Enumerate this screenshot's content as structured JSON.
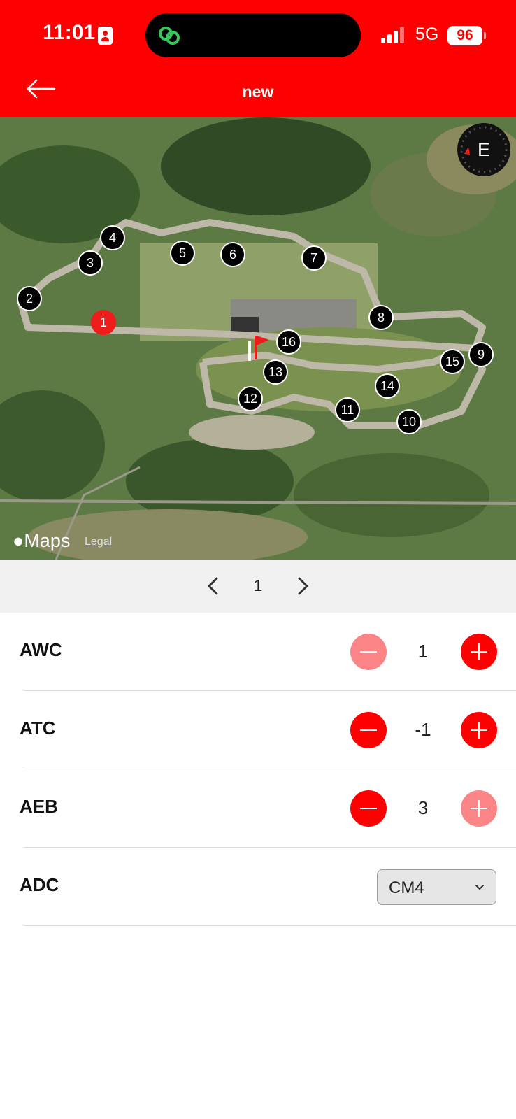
{
  "status_bar": {
    "time": "11:01",
    "network": "5G",
    "battery": "96"
  },
  "nav": {
    "title": "new"
  },
  "map": {
    "compass_letter": "E",
    "attribution": "Maps",
    "legal_label": "Legal",
    "turns": [
      "1",
      "2",
      "3",
      "4",
      "5",
      "6",
      "7",
      "8",
      "9",
      "10",
      "11",
      "12",
      "13",
      "14",
      "15",
      "16"
    ],
    "active_turn": "1"
  },
  "pager": {
    "current": "1"
  },
  "settings": {
    "awc": {
      "label": "AWC",
      "value": "1",
      "minus_enabled": false,
      "plus_enabled": true
    },
    "atc": {
      "label": "ATC",
      "value": "-1",
      "minus_enabled": true,
      "plus_enabled": true
    },
    "aeb": {
      "label": "AEB",
      "value": "3",
      "minus_enabled": true,
      "plus_enabled": false
    },
    "adc": {
      "label": "ADC",
      "value": "CM4"
    }
  },
  "colors": {
    "brand": "#fe0000",
    "brand_disabled": "#fb8586",
    "pager_bg": "#f1f1f1"
  }
}
